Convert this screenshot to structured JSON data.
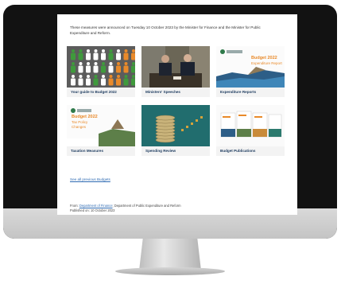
{
  "intro_text": "These measures were announced on Tuesday 10 October 2023 by the Minister for Finance and the Minister for Public Expenditure and Reform.",
  "cards": [
    {
      "label": "Your guide to Budget 2022"
    },
    {
      "label": "Ministers' Speeches"
    },
    {
      "label": "Expenditure Reports",
      "thumb_title": "Budget 2022",
      "thumb_subtitle": "Expenditure Report"
    },
    {
      "label": "Taxation Measures",
      "thumb_title": "Budget 2022",
      "thumb_subtitle": "Tax Policy Changes"
    },
    {
      "label": "Spending Review"
    },
    {
      "label": "Budget Publications"
    }
  ],
  "see_all_label": "See all previous Budgets",
  "footer": {
    "from_label": "From:",
    "dept_finance": "Department of Finance",
    "dept_per": "; Department of Public Expenditure and Reform",
    "published": "Published on: 10 October 2023"
  },
  "colors": {
    "accent": "#1c3a5e",
    "link": "#2f6bb3",
    "orange": "#e98a2a"
  }
}
